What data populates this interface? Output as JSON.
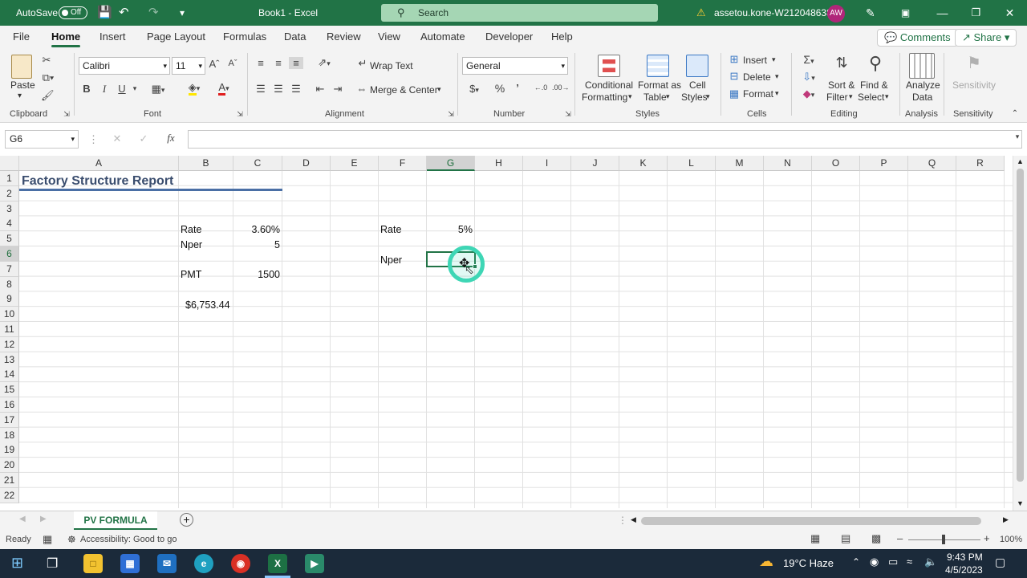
{
  "titlebar": {
    "autosave_label": "AutoSave",
    "autosave_state": "Off",
    "document_title": "Book1  -  Excel",
    "search_placeholder": "Search",
    "account": "assetou.kone-W212048638",
    "avatar_initials": "AW"
  },
  "menu": {
    "tabs": [
      "File",
      "Home",
      "Insert",
      "Page Layout",
      "Formulas",
      "Data",
      "Review",
      "View",
      "Automate",
      "Developer",
      "Help"
    ],
    "active": "Home",
    "comments": "Comments",
    "share": "Share"
  },
  "ribbon": {
    "clipboard": {
      "group": "Clipboard",
      "paste": "Paste"
    },
    "font": {
      "group": "Font",
      "name": "Calibri",
      "size": "11",
      "bold": "B",
      "italic": "I",
      "underline": "U"
    },
    "alignment": {
      "group": "Alignment",
      "wrap_text": "Wrap Text",
      "merge_center": "Merge & Center"
    },
    "number": {
      "group": "Number",
      "format": "General"
    },
    "styles": {
      "group": "Styles",
      "conditional": [
        "Conditional",
        "Formatting"
      ],
      "format_table": [
        "Format as",
        "Table"
      ],
      "cell_styles": [
        "Cell",
        "Styles"
      ]
    },
    "cells": {
      "group": "Cells",
      "insert": "Insert",
      "delete": "Delete",
      "format": "Format"
    },
    "editing": {
      "group": "Editing",
      "sort_filter": [
        "Sort &",
        "Filter"
      ],
      "find_select": [
        "Find &",
        "Select"
      ]
    },
    "analysis": {
      "group": "Analysis",
      "analyze": [
        "Analyze",
        "Data"
      ]
    },
    "sensitivity": {
      "group": "Sensitivity",
      "label": "Sensitivity"
    }
  },
  "formula_bar": {
    "name_box": "G6",
    "fx": "fx",
    "formula": ""
  },
  "grid": {
    "columns": [
      "A",
      "B",
      "C",
      "D",
      "E",
      "F",
      "G",
      "H",
      "I",
      "J",
      "K",
      "L",
      "M",
      "N",
      "O",
      "P",
      "Q",
      "R"
    ],
    "selected_column": "G",
    "rows": [
      "1",
      "2",
      "3",
      "4",
      "5",
      "6",
      "7",
      "8",
      "9",
      "10",
      "11",
      "12",
      "13",
      "14",
      "15",
      "16",
      "17",
      "18",
      "19",
      "20",
      "21",
      "22"
    ],
    "selected_row": "6",
    "cells": {
      "A1": "Factory Structure Report",
      "B4": "Rate",
      "C4": "3.60%",
      "B5": "Nper",
      "C5": "5",
      "B7": "PMT",
      "C7": "1500",
      "B9": "$6,753.44",
      "F4": "Rate",
      "G4": "5%",
      "F6": "Nper"
    }
  },
  "sheets": {
    "active": "PV FORMULA"
  },
  "status": {
    "ready": "Ready",
    "accessibility": "Accessibility: Good to go",
    "zoom": "100%"
  },
  "taskbar": {
    "weather": "19°C  Haze",
    "time": "9:43 PM",
    "date": "4/5/2023"
  }
}
